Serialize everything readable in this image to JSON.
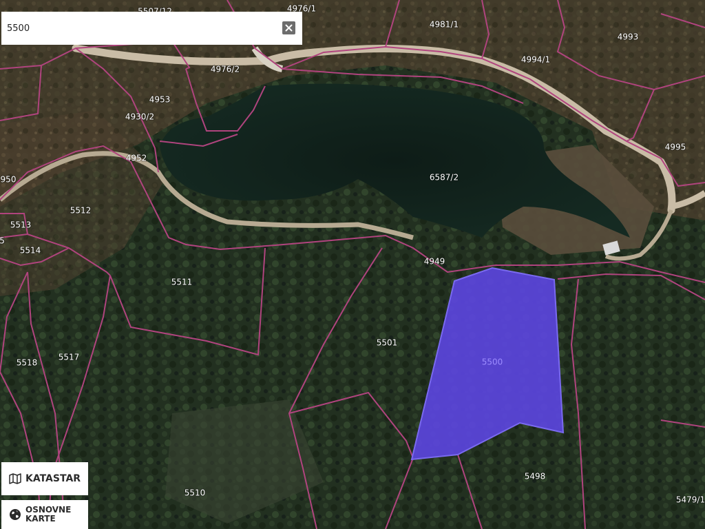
{
  "search": {
    "value": "5500"
  },
  "selected_parcel": {
    "label": "5500",
    "fill_color": "#5b45dd"
  },
  "parcels": [
    "4976/1",
    "5507/12",
    "4981/1",
    "4993",
    "4994/1",
    "4976/2",
    "4953",
    "4930/2",
    "4995",
    "4952",
    "950",
    "6587/2",
    "5512",
    "5513",
    "5514",
    "5",
    "4949",
    "5511",
    "5501",
    "5518",
    "5517",
    "5498",
    "5510",
    "5479/1"
  ],
  "buttons": {
    "cadastre": "KATASTAR",
    "basemaps_line1": "OSNOVNE",
    "basemaps_line2": "KARTE"
  },
  "colors": {
    "parcel_line": "#b0447e",
    "road": "#c6b9a4",
    "water": "#0f1f1a",
    "forest": "#1e2a1b"
  },
  "icons": {
    "clear": "close-icon",
    "cadastre": "map-icon",
    "basemaps": "globe-icon"
  }
}
